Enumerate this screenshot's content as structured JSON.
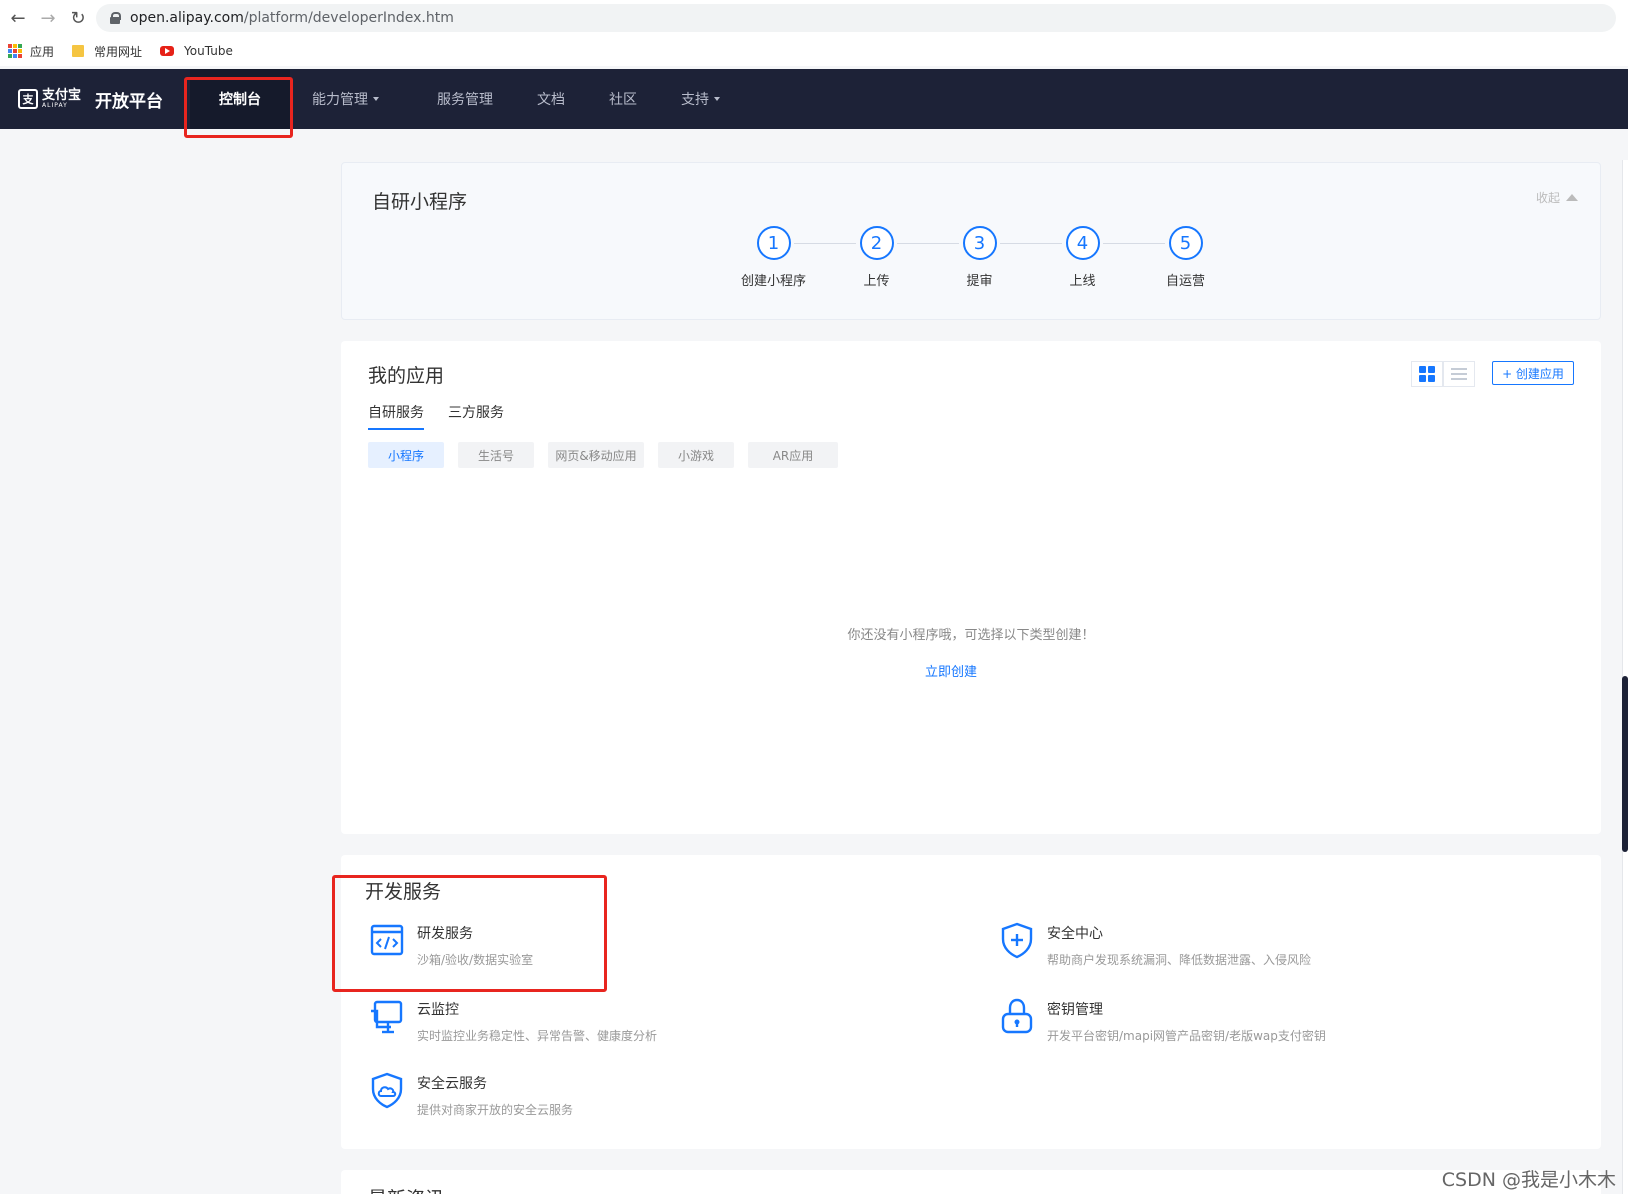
{
  "browser": {
    "url_domain": "open.alipay.com",
    "url_path": "/platform/developerIndex.htm",
    "bookmarks": [
      {
        "label": "应用"
      },
      {
        "label": "常用网址"
      },
      {
        "label": "YouTube"
      }
    ]
  },
  "topnav": {
    "brand_sub": "支付宝",
    "brand_sub_en": "ALIPAY",
    "brand_title": "开放平台",
    "items": [
      {
        "label": "控制台",
        "active": true
      },
      {
        "label": "能力管理",
        "dropdown": true
      },
      {
        "label": "服务管理"
      },
      {
        "label": "文档"
      },
      {
        "label": "社区"
      },
      {
        "label": "支持",
        "dropdown": true
      }
    ]
  },
  "steps_card": {
    "title": "自研小程序",
    "collapse_label": "收起",
    "steps": [
      {
        "num": "1",
        "label": "创建小程序"
      },
      {
        "num": "2",
        "label": "上传"
      },
      {
        "num": "3",
        "label": "提审"
      },
      {
        "num": "4",
        "label": "上线"
      },
      {
        "num": "5",
        "label": "自运营"
      }
    ]
  },
  "apps_card": {
    "title": "我的应用",
    "create_button": "+ 创建应用",
    "tabs": [
      {
        "label": "自研服务",
        "active": true
      },
      {
        "label": "三方服务"
      }
    ],
    "chips": [
      {
        "label": "小程序",
        "active": true
      },
      {
        "label": "生活号"
      },
      {
        "label": "网页&移动应用"
      },
      {
        "label": "小游戏"
      },
      {
        "label": "AR应用"
      }
    ],
    "empty_text": "你还没有小程序哦，可选择以下类型创建！",
    "create_link": "立即创建"
  },
  "dev_card": {
    "title": "开发服务",
    "services": [
      {
        "title": "研发服务",
        "desc": "沙箱/验收/数据实验室",
        "icon": "code-window-icon"
      },
      {
        "title": "安全中心",
        "desc": "帮助商户发现系统漏洞、降低数据泄露、入侵风险",
        "icon": "shield-plus-icon"
      },
      {
        "title": "云监控",
        "desc": "实时监控业务稳定性、异常告警、健康度分析",
        "icon": "monitor-icon"
      },
      {
        "title": "密钥管理",
        "desc": "开发平台密钥/mapi网管产品密钥/老版wap支付密钥",
        "icon": "lock-icon"
      },
      {
        "title": "安全云服务",
        "desc": "提供对商家开放的安全云服务",
        "icon": "shield-cloud-icon"
      }
    ]
  },
  "next_card": {
    "title": "最新资讯"
  },
  "watermark": "CSDN @我是小木木",
  "colors": {
    "accent": "#1677ff",
    "nav_bg": "#1d2237",
    "highlight": "#e8251f"
  }
}
